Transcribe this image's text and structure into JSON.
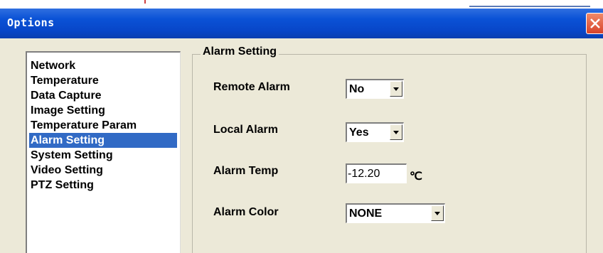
{
  "window": {
    "title": "Options"
  },
  "sidebar": {
    "items": [
      {
        "label": "Network"
      },
      {
        "label": "Temperature"
      },
      {
        "label": "Data Capture"
      },
      {
        "label": "Image Setting"
      },
      {
        "label": "Temperature Param"
      },
      {
        "label": "Alarm Setting",
        "selected": true
      },
      {
        "label": "System Setting"
      },
      {
        "label": "Video Setting"
      },
      {
        "label": "PTZ Setting"
      }
    ]
  },
  "alarm": {
    "group_title": "Alarm Setting",
    "remote_alarm": {
      "label": "Remote Alarm",
      "value": "No"
    },
    "local_alarm": {
      "label": "Local Alarm",
      "value": "Yes"
    },
    "alarm_temp": {
      "label": "Alarm Temp",
      "value": "-12.20",
      "unit": "℃"
    },
    "alarm_color": {
      "label": "Alarm Color",
      "value": "NONE"
    }
  },
  "colors": {
    "title_bar": "#0a52d6",
    "selection": "#316ac5",
    "dialog_bg": "#ece9d8"
  }
}
